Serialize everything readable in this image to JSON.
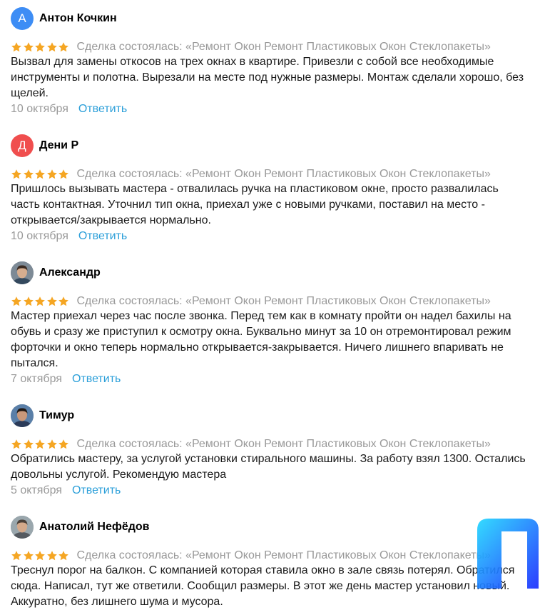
{
  "reviews": [
    {
      "name": "Антон Кочкин",
      "initial": "А",
      "avatar_color": "#3d8df5",
      "avatar_type": "letter",
      "rating": 5,
      "deal": "Сделка состоялась: «Ремонт Окон Ремонт Пластиковых Окон Стеклопакеты»",
      "text": "Вызвал для замены откосов на трех окнах в квартире. Привезли с собой все необходимые инструменты и полотна. Вырезали на месте под нужные размеры. Монтаж сделали хорошо, без щелей.",
      "date": "10 октября",
      "reply": "Ответить"
    },
    {
      "name": "Дени Р",
      "initial": "Д",
      "avatar_color": "#f04e4e",
      "avatar_type": "letter",
      "rating": 5,
      "deal": "Сделка состоялась: «Ремонт Окон Ремонт Пластиковых Окон Стеклопакеты»",
      "text": "Пришлось вызывать мастера - отвалилась ручка на пластиковом окне, просто развалилась часть контактная. Уточнил тип окна, приехал уже с новыми ручками, поставил на место - открывается/закрывается нормально.",
      "date": "10 октября",
      "reply": "Ответить"
    },
    {
      "name": "Александр",
      "avatar_type": "photo",
      "rating": 5,
      "deal": "Сделка состоялась: «Ремонт Окон Ремонт Пластиковых Окон Стеклопакеты»",
      "text": "Мастер приехал через час после звонка. Перед тем как в комнату пройти он надел бахилы на обувь и сразу же приступил к осмотру окна. Буквально минут за 10 он отремонтировал режим форточки и окно теперь нормально открывается-закрывается. Ничего лишнего впаривать не пытался.",
      "date": "7 октября",
      "reply": "Ответить"
    },
    {
      "name": "Тимур",
      "avatar_type": "photo",
      "rating": 5,
      "deal": "Сделка состоялась: «Ремонт Окон Ремонт Пластиковых Окон Стеклопакеты»",
      "text": "Обратились мастеру, за услугой установки стирального машины. За работу взял 1300. Остались довольны услугой. Рекомендую мастера",
      "date": "5 октября",
      "reply": "Ответить"
    },
    {
      "name": "Анатолий Нефёдов",
      "avatar_type": "photo",
      "rating": 5,
      "deal": "Сделка состоялась: «Ремонт Окон Ремонт Пластиковых Окон Стеклопакеты»",
      "text": "Треснул порог на балкон. С компанией которая ставила окно в зале связь потерял. Обратился сюда. Написал, тут же ответили. Сообщил размеры. В этот же день мастер установил новый. Аккуратно, без лишнего шума и мусора.",
      "date": "",
      "reply": ""
    }
  ],
  "colors": {
    "star": "#f5a623",
    "meta_gray": "#999999",
    "reply_blue": "#2b9fd9",
    "logo_gradient_top": "#00e0ff",
    "logo_gradient_bottom": "#1a2cff"
  },
  "icons": {
    "rating_star": "star-icon",
    "watermark": "app-logo-icon"
  }
}
